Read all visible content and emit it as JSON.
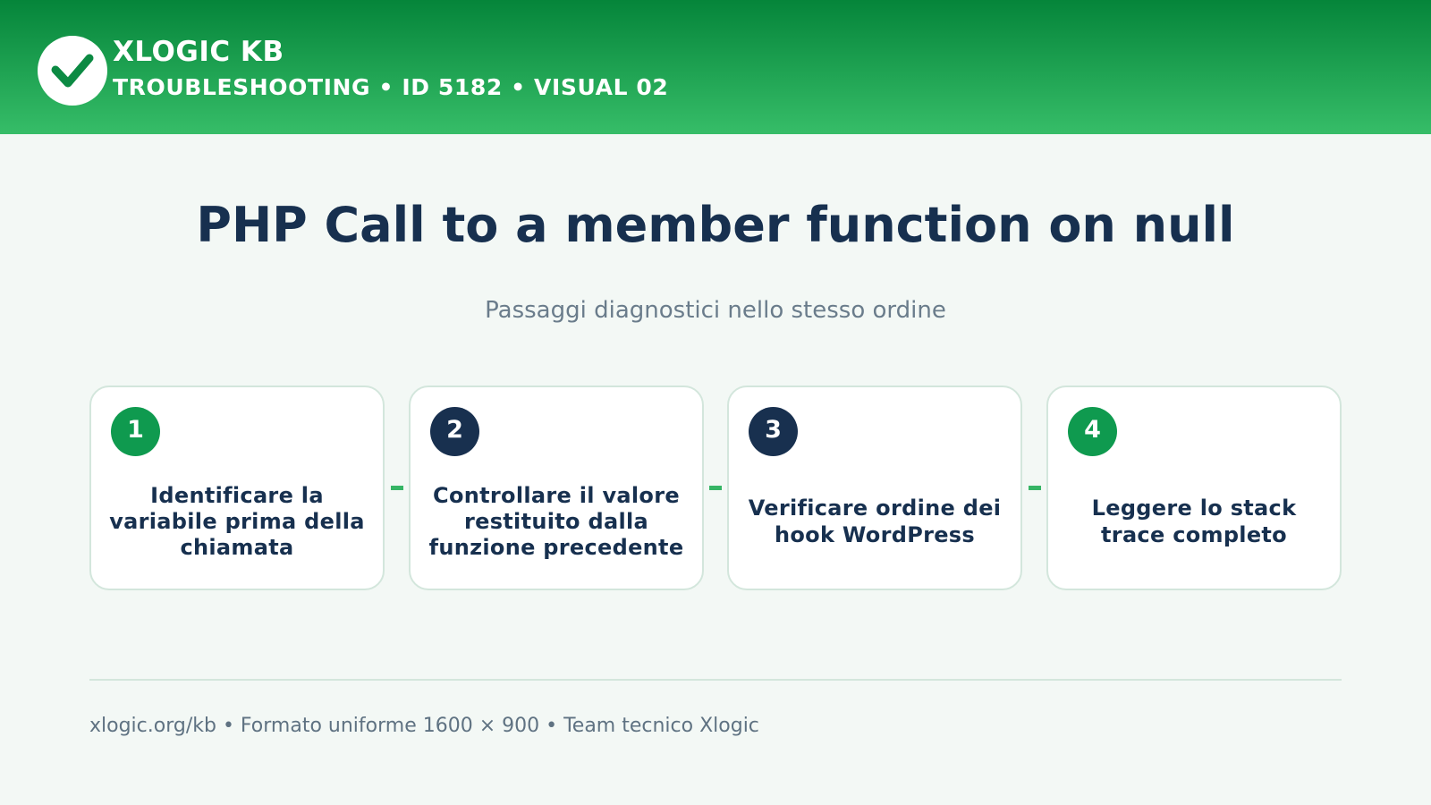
{
  "header": {
    "brand": "XLOGIC KB",
    "meta": "TROUBLESHOOTING • ID 5182 • VISUAL 02",
    "logo_icon": "check-icon"
  },
  "title": "PHP Call to a member function on null",
  "subtitle": "Passaggi diagnostici nello stesso ordine",
  "steps": [
    {
      "number": "1",
      "text": "Identificare la variabile prima della chiamata",
      "badge_color": "#0f9a4f"
    },
    {
      "number": "2",
      "text": "Controllare il valore restituito dalla funzione precedente",
      "badge_color": "#18304f"
    },
    {
      "number": "3",
      "text": "Verificare ordine dei hook WordPress",
      "badge_color": "#18304f"
    },
    {
      "number": "4",
      "text": "Leggere lo stack trace completo",
      "badge_color": "#0f9a4f"
    }
  ],
  "footer": "xlogic.org/kb • Formato uniforme 1600 × 900 • Team tecnico Xlogic",
  "colors": {
    "header_dark": "#05853a",
    "header_light": "#36bd68",
    "title": "#17304f",
    "connector": "#36b565"
  }
}
